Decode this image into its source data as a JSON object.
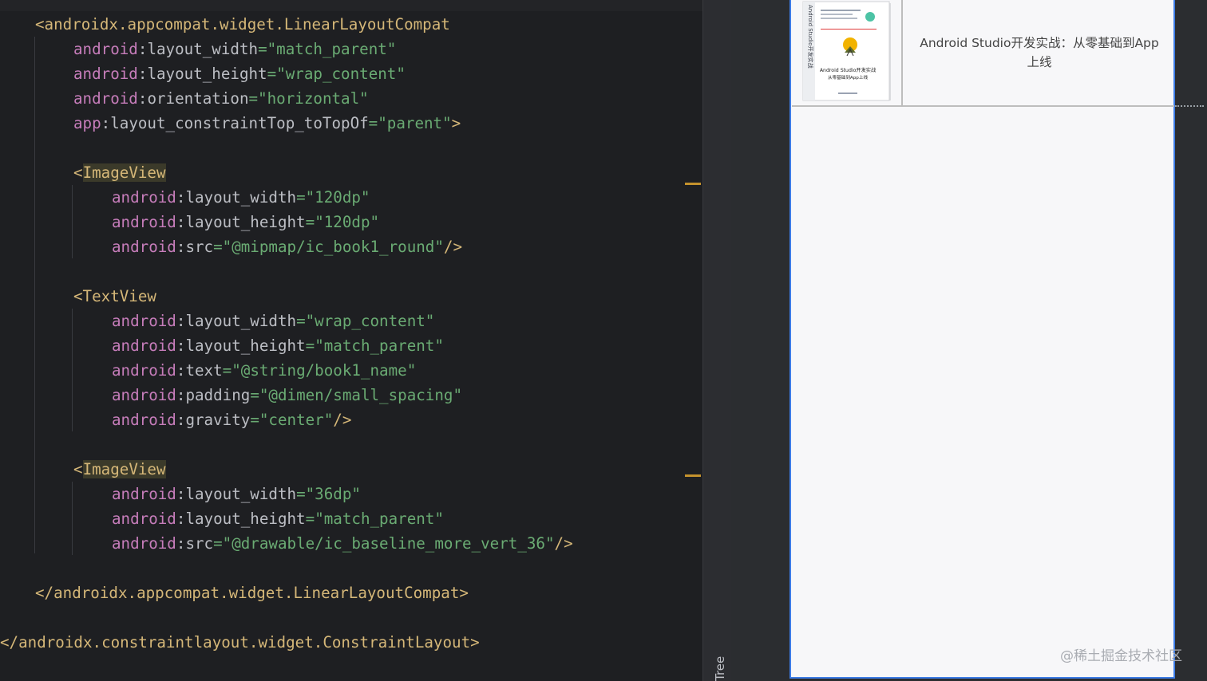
{
  "editor": {
    "lines": [
      [
        {
          "t": "tag",
          "s": "<androidx.appcompat.widget.LinearLayoutCompat"
        }
      ],
      [
        {
          "t": "ns",
          "s": "android"
        },
        {
          "t": "punct",
          "s": ":"
        },
        {
          "t": "attr",
          "s": "layout_width"
        },
        {
          "t": "eq",
          "s": "="
        },
        {
          "t": "str",
          "s": "\"match_parent\""
        }
      ],
      [
        {
          "t": "ns",
          "s": "android"
        },
        {
          "t": "punct",
          "s": ":"
        },
        {
          "t": "attr",
          "s": "layout_height"
        },
        {
          "t": "eq",
          "s": "="
        },
        {
          "t": "str",
          "s": "\"wrap_content\""
        }
      ],
      [
        {
          "t": "ns",
          "s": "android"
        },
        {
          "t": "punct",
          "s": ":"
        },
        {
          "t": "attr",
          "s": "orientation"
        },
        {
          "t": "eq",
          "s": "="
        },
        {
          "t": "str",
          "s": "\"horizontal\""
        }
      ],
      [
        {
          "t": "ns",
          "s": "app"
        },
        {
          "t": "punct",
          "s": ":"
        },
        {
          "t": "attr",
          "s": "layout_constraintTop_toTopOf"
        },
        {
          "t": "eq",
          "s": "="
        },
        {
          "t": "str",
          "s": "\"parent\""
        },
        {
          "t": "tag",
          "s": ">"
        }
      ],
      [],
      [
        {
          "t": "tag",
          "s": "<"
        },
        {
          "t": "tag hl",
          "s": "ImageView"
        }
      ],
      [
        {
          "t": "ns",
          "s": "android"
        },
        {
          "t": "punct",
          "s": ":"
        },
        {
          "t": "attr",
          "s": "layout_width"
        },
        {
          "t": "eq",
          "s": "="
        },
        {
          "t": "str",
          "s": "\"120dp\""
        }
      ],
      [
        {
          "t": "ns",
          "s": "android"
        },
        {
          "t": "punct",
          "s": ":"
        },
        {
          "t": "attr",
          "s": "layout_height"
        },
        {
          "t": "eq",
          "s": "="
        },
        {
          "t": "str",
          "s": "\"120dp\""
        }
      ],
      [
        {
          "t": "ns",
          "s": "android"
        },
        {
          "t": "punct",
          "s": ":"
        },
        {
          "t": "attr",
          "s": "src"
        },
        {
          "t": "eq",
          "s": "="
        },
        {
          "t": "str",
          "s": "\"@mipmap/ic_book1_round\""
        },
        {
          "t": "tag",
          "s": "/>"
        }
      ],
      [],
      [
        {
          "t": "tag",
          "s": "<TextView"
        }
      ],
      [
        {
          "t": "ns",
          "s": "android"
        },
        {
          "t": "punct",
          "s": ":"
        },
        {
          "t": "attr",
          "s": "layout_width"
        },
        {
          "t": "eq",
          "s": "="
        },
        {
          "t": "str",
          "s": "\"wrap_content\""
        }
      ],
      [
        {
          "t": "ns",
          "s": "android"
        },
        {
          "t": "punct",
          "s": ":"
        },
        {
          "t": "attr",
          "s": "layout_height"
        },
        {
          "t": "eq",
          "s": "="
        },
        {
          "t": "str",
          "s": "\"match_parent\""
        }
      ],
      [
        {
          "t": "ns",
          "s": "android"
        },
        {
          "t": "punct",
          "s": ":"
        },
        {
          "t": "attr",
          "s": "text"
        },
        {
          "t": "eq",
          "s": "="
        },
        {
          "t": "str",
          "s": "\"@string/book1_name\""
        }
      ],
      [
        {
          "t": "ns",
          "s": "android"
        },
        {
          "t": "punct",
          "s": ":"
        },
        {
          "t": "attr",
          "s": "padding"
        },
        {
          "t": "eq",
          "s": "="
        },
        {
          "t": "str",
          "s": "\"@dimen/small_spacing\""
        }
      ],
      [
        {
          "t": "ns",
          "s": "android"
        },
        {
          "t": "punct",
          "s": ":"
        },
        {
          "t": "attr",
          "s": "gravity"
        },
        {
          "t": "eq",
          "s": "="
        },
        {
          "t": "str",
          "s": "\"center\""
        },
        {
          "t": "tag",
          "s": "/>"
        }
      ],
      [],
      [
        {
          "t": "tag",
          "s": "<"
        },
        {
          "t": "tag hl",
          "s": "ImageView"
        }
      ],
      [
        {
          "t": "ns",
          "s": "android"
        },
        {
          "t": "punct",
          "s": ":"
        },
        {
          "t": "attr",
          "s": "layout_width"
        },
        {
          "t": "eq",
          "s": "="
        },
        {
          "t": "str",
          "s": "\"36dp\""
        }
      ],
      [
        {
          "t": "ns",
          "s": "android"
        },
        {
          "t": "punct",
          "s": ":"
        },
        {
          "t": "attr",
          "s": "layout_height"
        },
        {
          "t": "eq",
          "s": "="
        },
        {
          "t": "str",
          "s": "\"match_parent\""
        }
      ],
      [
        {
          "t": "ns",
          "s": "android"
        },
        {
          "t": "punct",
          "s": ":"
        },
        {
          "t": "attr",
          "s": "src"
        },
        {
          "t": "eq",
          "s": "="
        },
        {
          "t": "str",
          "s": "\"@drawable/ic_baseline_more_vert_36\""
        },
        {
          "t": "tag",
          "s": "/>"
        }
      ],
      [],
      [
        {
          "t": "tag",
          "s": "</androidx.appcompat.widget.LinearLayoutCompat>"
        }
      ],
      [],
      [
        {
          "t": "tag",
          "s": "</androidx.constraintlayout.widget.ConstraintLayout>"
        }
      ]
    ]
  },
  "tool_window": {
    "tree_label": "Tree"
  },
  "preview": {
    "book_name": "Android Studio开发实战：从零基础到App上线",
    "cover": {
      "spine_text": "Android Studio开发实战",
      "title": "Android Studio开发实战",
      "subtitle": "从零基础到App上线",
      "accent_color": "#f2b300"
    }
  },
  "watermark": "@稀土掘金技术社区"
}
